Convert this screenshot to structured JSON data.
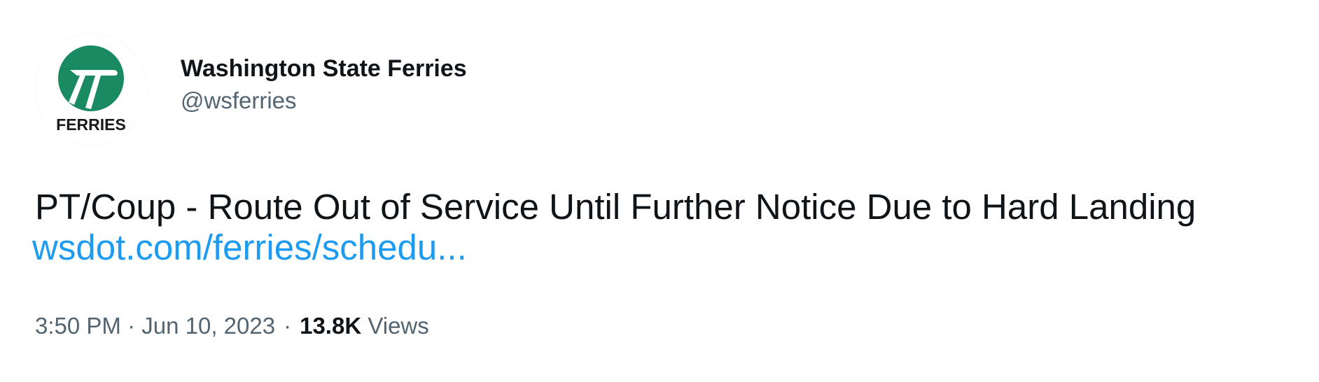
{
  "author": {
    "display_name": "Washington State Ferries",
    "handle": "@wsferries",
    "avatar_text": "FERRIES",
    "avatar_color": "#1a8a62"
  },
  "tweet": {
    "text": "PT/Coup - Route Out of Service Until Further Notice Due to Hard Landing",
    "link": "wsdot.com/ferries/schedu..."
  },
  "meta": {
    "time": "3:50 PM",
    "dot1": "·",
    "date": "Jun 10, 2023",
    "dot2": "·",
    "views_count": "13.8K",
    "views_label": "Views"
  },
  "colors": {
    "text_primary": "#0f1419",
    "text_secondary": "#536471",
    "link": "#1d9bf0"
  }
}
